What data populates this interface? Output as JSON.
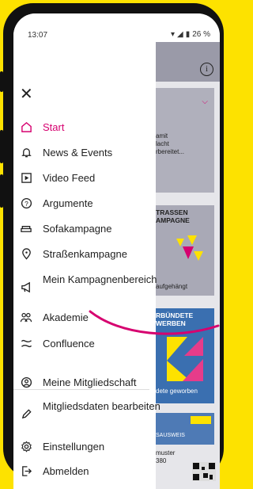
{
  "status": {
    "time": "13:07",
    "battery": "26 %"
  },
  "menu": {
    "items": [
      {
        "label": "Start",
        "icon": "home-icon"
      },
      {
        "label": "News & Events",
        "icon": "bell-icon"
      },
      {
        "label": "Video Feed",
        "icon": "video-icon"
      },
      {
        "label": "Argumente",
        "icon": "question-icon"
      },
      {
        "label": "Sofakampagne",
        "icon": "sofa-icon"
      },
      {
        "label": "Straßenkampagne",
        "icon": "location-icon"
      },
      {
        "label": "Mein Kampagnenbereich",
        "icon": "megaphone-icon"
      },
      {
        "label": "Akademie",
        "icon": "people-icon"
      },
      {
        "label": "Confluence",
        "icon": "confluence-icon"
      },
      {
        "label": "Meine Mitgliedschaft",
        "icon": "user-circle-icon"
      },
      {
        "label": "Mitgliedsdaten bearbeiten",
        "icon": "pencil-icon"
      },
      {
        "label": "Einstellungen",
        "icon": "gear-icon"
      },
      {
        "label": "Abmelden",
        "icon": "logout-icon"
      }
    ]
  },
  "background": {
    "card1_text": "amit\nlacht\nrbereitet...",
    "card2_title": "TRASSEN\nAMPAGNE",
    "card2_text": "aufgehängt",
    "card3_title": "RBÜNDETE\nWERBEN",
    "card3_text": "dete geworben",
    "card4_title": "SAUSWEIS",
    "card4_text": "muster\n380"
  },
  "colors": {
    "accent": "#d6006f",
    "brand_yellow": "#fde200"
  }
}
